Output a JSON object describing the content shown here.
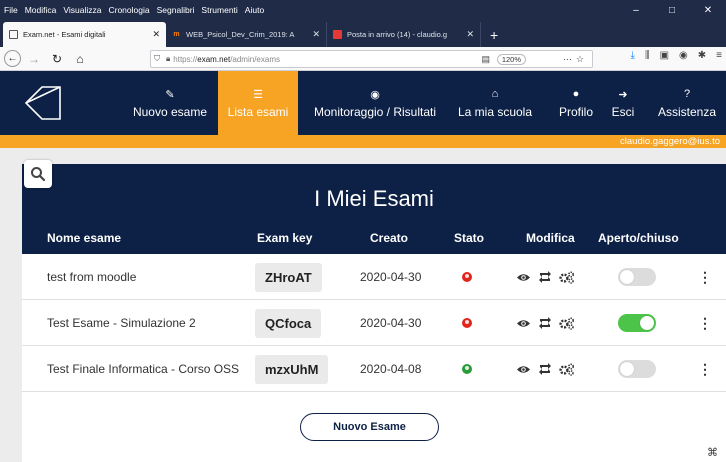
{
  "browser": {
    "menu": [
      "File",
      "Modifica",
      "Visualizza",
      "Cronologia",
      "Segnalibri",
      "Strumenti",
      "Aiuto"
    ],
    "window_controls": [
      "–",
      "□",
      "✕"
    ],
    "tabs": [
      {
        "title": "Exam.net - Esami digitali",
        "active": true,
        "favicon": "exam-icon"
      },
      {
        "title": "WEB_Psicol_Dev_Crim_2019: A",
        "active": false,
        "favicon": "moodle-icon"
      },
      {
        "title": "Posta in arrivo (14) - claudio.g",
        "active": false,
        "favicon": "mail-icon"
      }
    ],
    "url_prefix": "https://",
    "url_host": "exam.net",
    "url_path": "/admin/exams",
    "zoom": "120%"
  },
  "app": {
    "nav": [
      {
        "label": "Nuovo esame",
        "icon": "pencil-icon"
      },
      {
        "label": "Lista esami",
        "icon": "list-icon",
        "active": true
      },
      {
        "label": "Monitoraggio / Risultati",
        "icon": "eye-icon"
      },
      {
        "label": "La mia scuola",
        "icon": "home-icon"
      },
      {
        "label": "Profilo",
        "icon": "user-icon"
      },
      {
        "label": "Esci",
        "icon": "logout-icon"
      },
      {
        "label": "Assistenza",
        "icon": "help-icon"
      }
    ],
    "user_email": "claudio.gaggero@ius.to"
  },
  "exams": {
    "title": "I Miei Esami",
    "columns": [
      "Nome esame",
      "Exam key",
      "Creato",
      "Stato",
      "Modifica",
      "Aperto/chiuso"
    ],
    "rows": [
      {
        "name": "test from moodle",
        "key": "ZHroAT",
        "created": "2020-04-30",
        "status": "red",
        "open": false
      },
      {
        "name": "Test Esame - Simulazione 2",
        "key": "QCfoca",
        "created": "2020-04-30",
        "status": "red",
        "open": true
      },
      {
        "name": "Test Finale Informatica - Corso OSS",
        "key": "mzxUhM",
        "created": "2020-04-08",
        "status": "green",
        "open": false
      }
    ],
    "new_button": "Nuovo Esame"
  },
  "colors": {
    "navy": "#0d2045",
    "orange": "#f7a324",
    "toggle_on": "#4cc449",
    "status_red": "#e0261b",
    "status_green": "#2a9b3b"
  }
}
